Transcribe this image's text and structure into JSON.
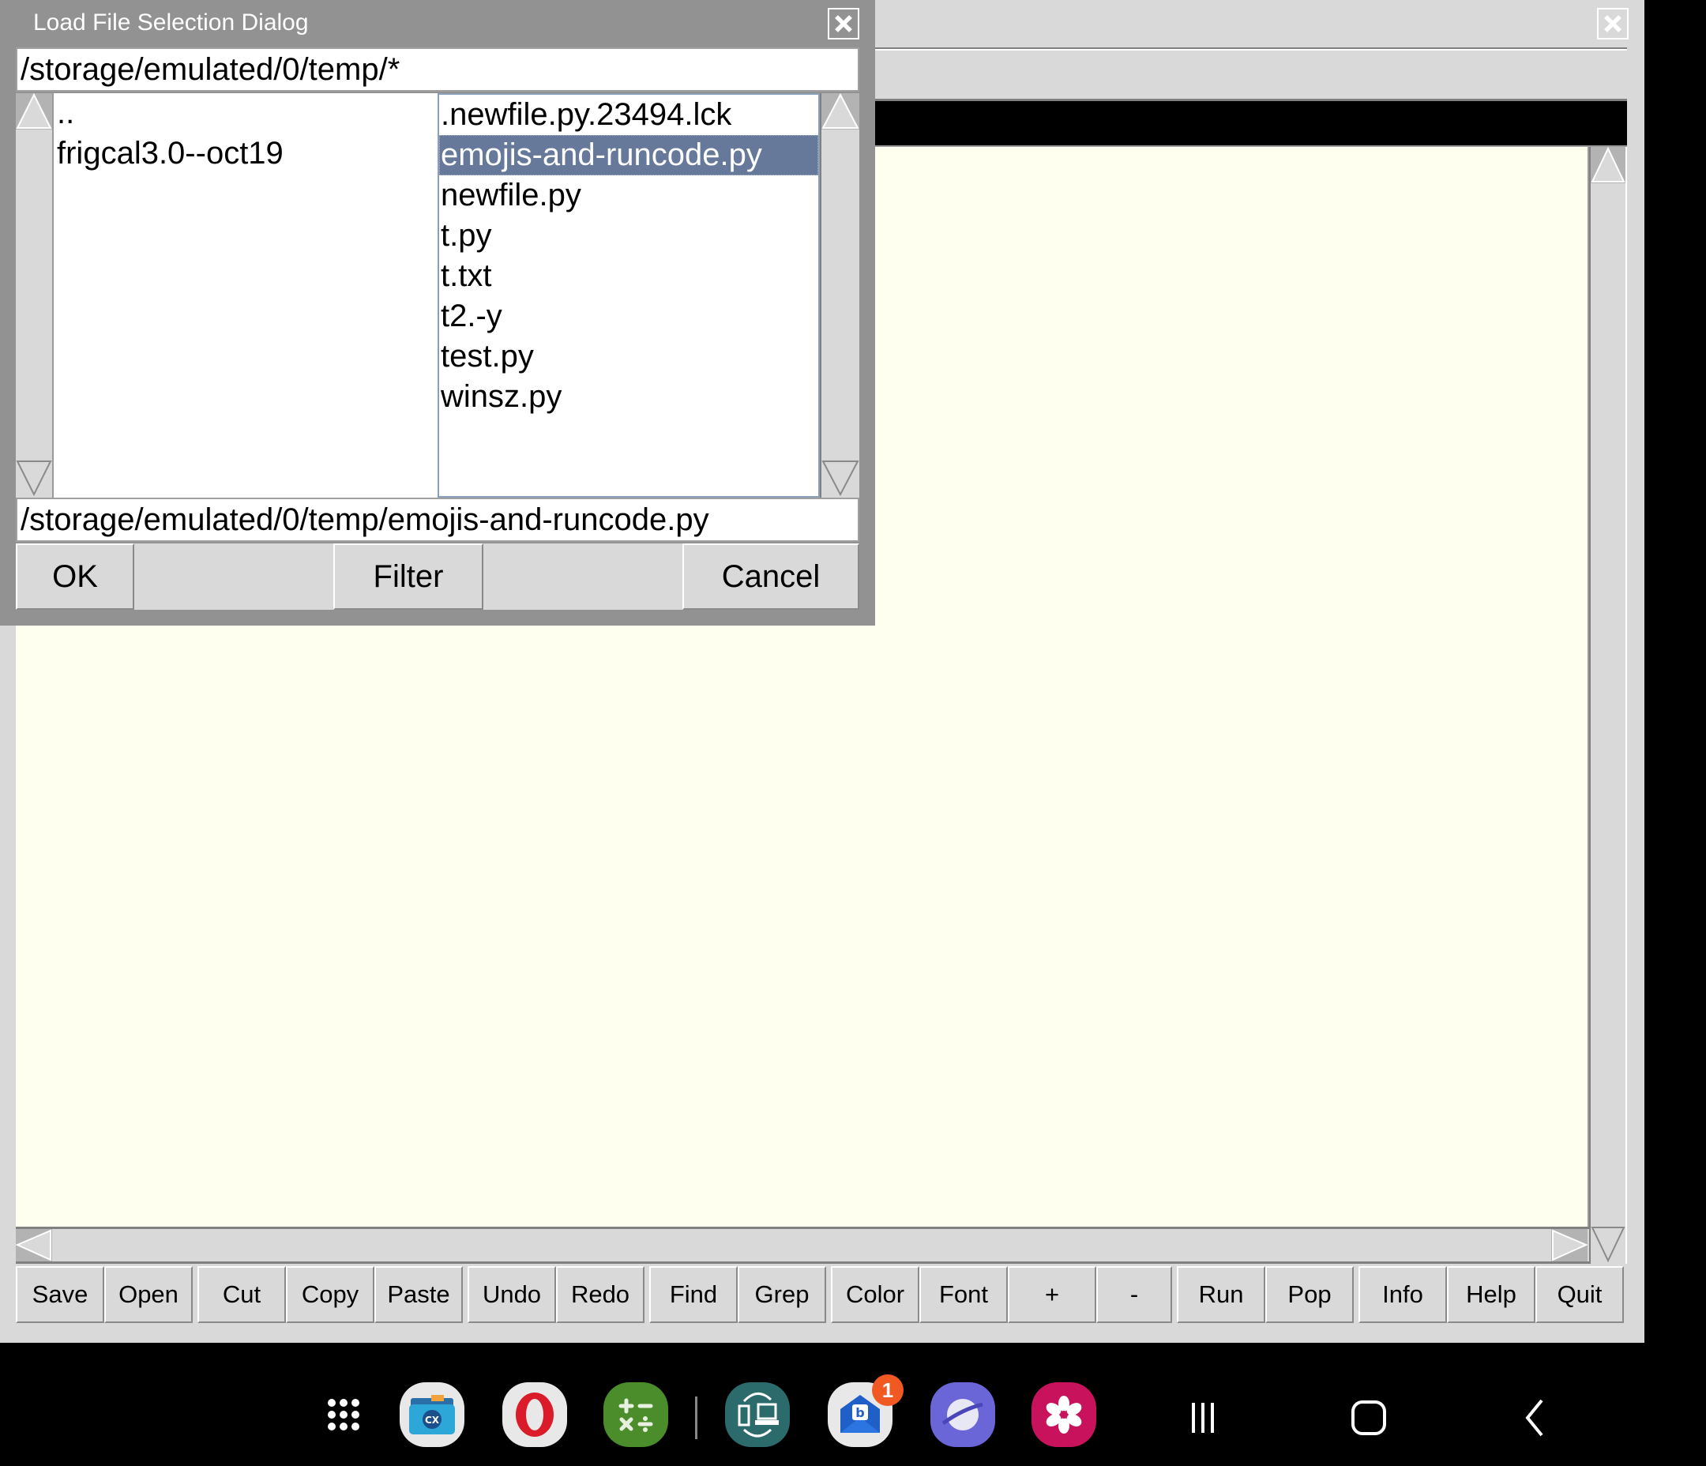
{
  "main_window": {
    "close_icon": "close-icon",
    "toolbar": [
      {
        "label": "Save"
      },
      {
        "label": "Open"
      },
      {
        "label": "Cut"
      },
      {
        "label": "Copy"
      },
      {
        "label": "Paste"
      },
      {
        "label": "Undo"
      },
      {
        "label": "Redo"
      },
      {
        "label": "Find"
      },
      {
        "label": "Grep"
      },
      {
        "label": "Color"
      },
      {
        "label": "Font"
      },
      {
        "label": "+"
      },
      {
        "label": "-"
      },
      {
        "label": "Run"
      },
      {
        "label": "Pop"
      },
      {
        "label": "Info"
      },
      {
        "label": "Help"
      },
      {
        "label": "Quit"
      }
    ],
    "editor_bg": "#fffff0"
  },
  "dialog": {
    "title": "Load File Selection Dialog",
    "filter_value": "/storage/emulated/0/temp/*",
    "directories": [
      {
        "name": ".."
      },
      {
        "name": "frigcal3.0--oct19"
      }
    ],
    "files": [
      {
        "name": ".newfile.py.23494.lck",
        "selected": false
      },
      {
        "name": "emojis-and-runcode.py",
        "selected": true
      },
      {
        "name": "newfile.py",
        "selected": false
      },
      {
        "name": "t.py",
        "selected": false
      },
      {
        "name": "t.txt",
        "selected": false
      },
      {
        "name": "t2.-y",
        "selected": false
      },
      {
        "name": "test.py",
        "selected": false
      },
      {
        "name": "winsz.py",
        "selected": false
      }
    ],
    "selection_value": "/storage/emulated/0/temp/emojis-and-runcode.py",
    "buttons": {
      "ok": "OK",
      "filter": "Filter",
      "cancel": "Cancel"
    },
    "selection_color": "#66799b"
  },
  "navbar": {
    "apps": [
      {
        "name": "app-drawer"
      },
      {
        "name": "cx-file-explorer"
      },
      {
        "name": "opera"
      },
      {
        "name": "calculator"
      },
      {
        "name": "sync-app"
      },
      {
        "name": "bluemail",
        "badge": "1"
      },
      {
        "name": "samsung-internet"
      },
      {
        "name": "blossom-app"
      }
    ],
    "badge_count": "1",
    "buttons": [
      "recents",
      "home",
      "back"
    ]
  }
}
